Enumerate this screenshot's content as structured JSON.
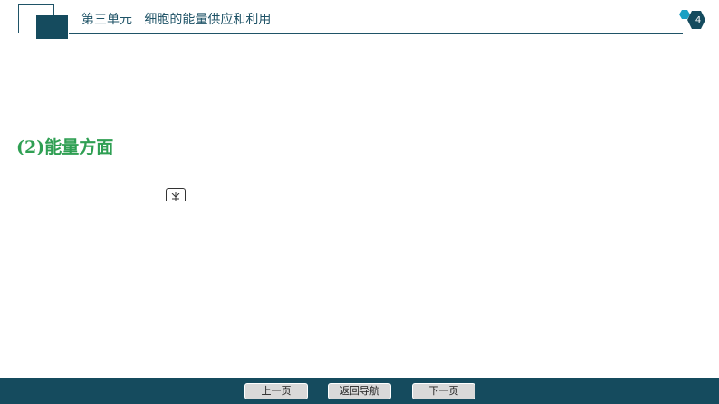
{
  "header": {
    "unit_label": "第三单元",
    "title": "细胞的能量供应和利用",
    "page_number": "4",
    "colors": {
      "primary": "#154b5e",
      "accent": "#1aa0c4"
    }
  },
  "content": {
    "section_heading": "(2)能量方面",
    "heading_color": "#2f9f53",
    "media_icon": "play-media-icon"
  },
  "footer": {
    "prev_label": "上一页",
    "home_label": "返回导航",
    "next_label": "下一页"
  }
}
